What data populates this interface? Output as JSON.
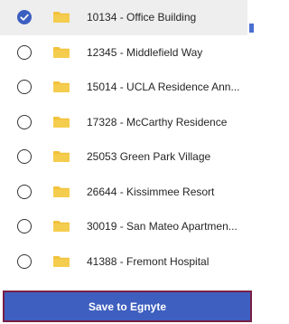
{
  "folders": [
    {
      "label": "10134 - Office Building",
      "selected": true
    },
    {
      "label": "12345 - Middlefield Way",
      "selected": false
    },
    {
      "label": "15014 - UCLA Residence Ann...",
      "selected": false
    },
    {
      "label": "17328 - McCarthy Residence",
      "selected": false
    },
    {
      "label": "25053 Green Park Village",
      "selected": false
    },
    {
      "label": "26644 - Kissimmee Resort",
      "selected": false
    },
    {
      "label": "30019 - San Mateo Apartmen...",
      "selected": false
    },
    {
      "label": "41388 - Fremont Hospital",
      "selected": false
    }
  ],
  "footer": {
    "save_label": "Save to Egnyte"
  },
  "icons": {
    "folder": "folder-icon",
    "radio_checked": "radio-checked-icon",
    "radio_unchecked": "radio-unchecked-icon"
  },
  "colors": {
    "accent": "#3e5fbf",
    "button_border": "#7a1f46",
    "folder": "#f2c23c",
    "selected_row_bg": "#eeeeee"
  }
}
